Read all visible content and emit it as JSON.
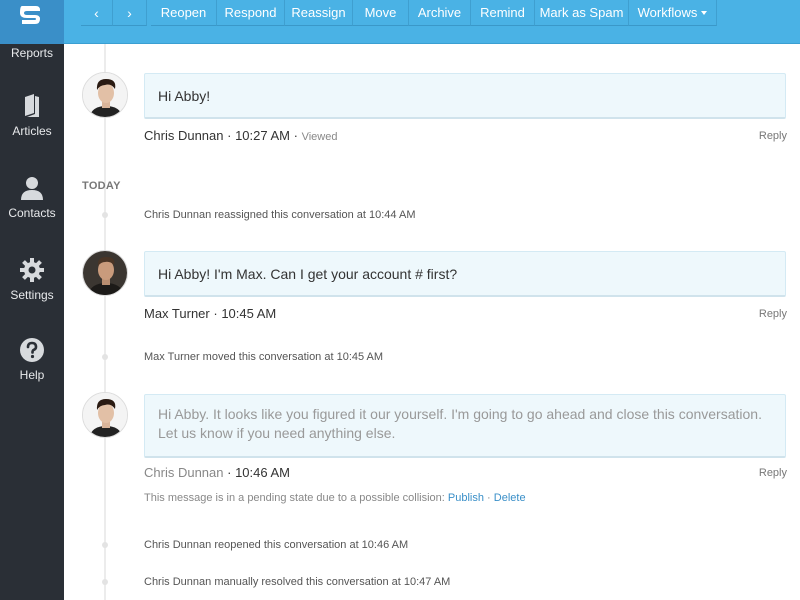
{
  "sidebar": {
    "items": [
      {
        "label": "Reports",
        "icon": "reports-icon"
      },
      {
        "label": "Articles",
        "icon": "book-icon"
      },
      {
        "label": "Contacts",
        "icon": "person-icon"
      },
      {
        "label": "Settings",
        "icon": "gear-icon"
      },
      {
        "label": "Help",
        "icon": "question-circle-icon"
      }
    ]
  },
  "toolbar": {
    "prev": "‹",
    "next": "›",
    "buttons": [
      "Reopen",
      "Respond",
      "Reassign",
      "Move",
      "Archive",
      "Remind",
      "Mark as Spam",
      "Workflows"
    ]
  },
  "thread": {
    "today_label": "TODAY",
    "messages": [
      {
        "text": "Hi Abby!",
        "author": "Chris Dunnan",
        "time": "10:27 AM",
        "status": "Viewed",
        "reply": "Reply"
      },
      {
        "text": "Hi Abby! I'm Max. Can I get your account # first?",
        "author": "Max Turner",
        "time": "10:45 AM",
        "reply": "Reply"
      },
      {
        "text": "Hi Abby. It looks like you figured it our yourself. I'm going to go ahead and close this conversation. Let us know if you need anything else.",
        "author": "Chris Dunnan",
        "time": "10:46 AM",
        "reply": "Reply"
      }
    ],
    "events": [
      "Chris Dunnan reassigned this conversation at 10:44 AM",
      "Max Turner moved this conversation at 10:45 AM",
      "Chris Dunnan reopened this conversation at 10:46 AM",
      "Chris Dunnan manually resolved this conversation at 10:47 AM"
    ],
    "pending_note": {
      "text": "This message is in a pending state due to a possible collision: ",
      "publish": "Publish",
      "separator": " · ",
      "delete": "Delete"
    }
  },
  "colors": {
    "accent": "#4ab2e5",
    "sidebar": "#2a2f36",
    "bubble": "#eef8fc",
    "link": "#3a8fc8"
  }
}
